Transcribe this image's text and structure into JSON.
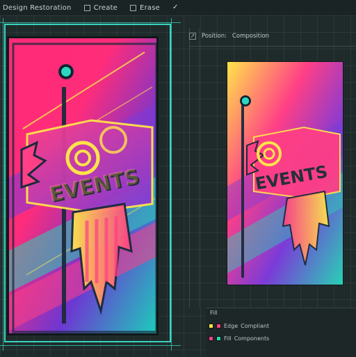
{
  "toolbar": {
    "title": "Design Restoration",
    "opt1_label": "Create",
    "opt2_label": "Erase",
    "check": "✓"
  },
  "panel": {
    "label1": "Position:",
    "label2": "Composition"
  },
  "artwork": {
    "text": "EVENTS"
  },
  "bottom_panel": {
    "tab": "Fill",
    "row1_label": "Edge",
    "row1_value": "Compliant",
    "row2_label": "Fill",
    "row2_value": "Components",
    "colors": {
      "yellow": "#ffe44a",
      "magenta": "#ff3f86",
      "teal": "#25d5b4",
      "violet": "#7b3bd8"
    }
  }
}
